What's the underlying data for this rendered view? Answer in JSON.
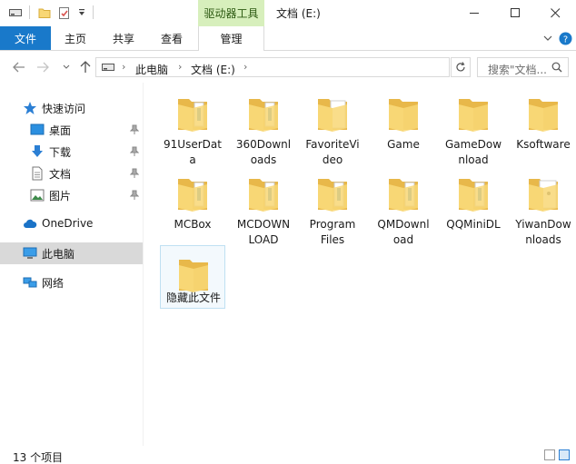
{
  "titlebar": {
    "context_tab": "驱动器工具",
    "title": "文档 (E:)",
    "minimize_label": "—",
    "maximize_label": "☐",
    "close_label": "✕"
  },
  "ribbon": {
    "file_tab": "文件",
    "tabs": [
      "主页",
      "共享",
      "查看"
    ],
    "manage_tab": "管理"
  },
  "address": {
    "crumbs": [
      "此电脑",
      "文档 (E:)"
    ],
    "search_placeholder": "搜索\"文档..."
  },
  "nav": {
    "quick_access": "快速访问",
    "quick_items": [
      {
        "label": "桌面",
        "icon": "desktop-icon"
      },
      {
        "label": "下载",
        "icon": "download-icon"
      },
      {
        "label": "文档",
        "icon": "document-icon"
      },
      {
        "label": "图片",
        "icon": "picture-icon"
      }
    ],
    "onedrive": "OneDrive",
    "this_pc": "此电脑",
    "network": "网络"
  },
  "files": [
    {
      "name": "91UserData",
      "line1": "91UserDat",
      "line2": "a",
      "variant": "docs"
    },
    {
      "name": "360Downloads",
      "line1": "360Downl",
      "line2": "oads",
      "variant": "docs"
    },
    {
      "name": "FavoriteVideo",
      "line1": "FavoriteVi",
      "line2": "deo",
      "variant": "white"
    },
    {
      "name": "Game",
      "line1": "Game",
      "line2": "",
      "variant": "plain"
    },
    {
      "name": "GameDownload",
      "line1": "GameDow",
      "line2": "nload",
      "variant": "plain"
    },
    {
      "name": "Ksoftware",
      "line1": "Ksoftware",
      "line2": "",
      "variant": "plain"
    },
    {
      "name": "MCBox",
      "line1": "MCBox",
      "line2": "",
      "variant": "docs"
    },
    {
      "name": "MCDOWNLOAD",
      "line1": "MCDOWN",
      "line2": "LOAD",
      "variant": "docs"
    },
    {
      "name": "Program Files",
      "line1": "Program",
      "line2": "Files",
      "variant": "docs"
    },
    {
      "name": "QMDownload",
      "line1": "QMDownl",
      "line2": "oad",
      "variant": "docs"
    },
    {
      "name": "QQMiniDL",
      "line1": "QQMiniDL",
      "line2": "",
      "variant": "docs"
    },
    {
      "name": "YiwanDownloads",
      "line1": "YiwanDow",
      "line2": "nloads",
      "variant": "white-doc"
    },
    {
      "name": "隐藏此文件",
      "line1": "隐藏此文件",
      "line2": "",
      "variant": "plain-selected"
    }
  ],
  "status": {
    "count_text": "13 个项目"
  },
  "colors": {
    "accent": "#1979ca",
    "context_tab_bg": "#d7efbc",
    "folder": "#f8d775",
    "folder_dark": "#e8b84a",
    "selected_nav": "#d9d9d9"
  }
}
